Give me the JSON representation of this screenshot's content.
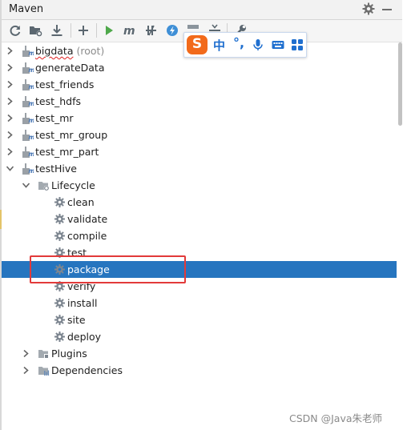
{
  "panel": {
    "title": "Maven",
    "settings_icon": "gear-icon",
    "minimize_icon": "minimize-icon"
  },
  "toolbar": {
    "buttons": [
      {
        "icon": "reload-icon",
        "name": "reload-projects-button"
      },
      {
        "icon": "generate-sources-icon",
        "name": "generate-sources-button"
      },
      {
        "icon": "download-icon",
        "name": "download-sources-button"
      },
      {
        "icon": "add-icon",
        "name": "add-project-button"
      },
      {
        "icon": "run-icon",
        "name": "run-build-button"
      },
      {
        "icon": "maven-goal-icon",
        "name": "execute-goal-button"
      },
      {
        "icon": "toggle-offline-icon",
        "name": "toggle-offline-button"
      },
      {
        "icon": "skip-tests-icon",
        "name": "skip-tests-button"
      },
      {
        "icon": "show-dependencies-icon",
        "name": "show-dependencies-button"
      },
      {
        "icon": "collapse-all-icon",
        "name": "collapse-all-button"
      },
      {
        "icon": "wrench-icon",
        "name": "maven-settings-button"
      }
    ]
  },
  "ime_toolbar": {
    "logo_letter": "S",
    "mode": "中",
    "punctuation": "°,",
    "icons": [
      "microphone-icon",
      "keyboard-icon",
      "grid-icon"
    ],
    "colors": {
      "logo": "#f26a1b",
      "accent": "#1f6fcf"
    }
  },
  "tree": {
    "projects": [
      {
        "label": "bigdata",
        "hint": "(root)",
        "expanded": false
      },
      {
        "label": "generateData",
        "expanded": false
      },
      {
        "label": "test_friends",
        "expanded": false
      },
      {
        "label": "test_hdfs",
        "expanded": false
      },
      {
        "label": "test_mr",
        "expanded": false
      },
      {
        "label": "test_mr_group",
        "expanded": false
      },
      {
        "label": "test_mr_part",
        "expanded": false
      },
      {
        "label": "testHive",
        "expanded": true
      }
    ],
    "lifecycle": {
      "label": "Lifecycle",
      "goals": [
        "clean",
        "validate",
        "compile",
        "test",
        "package",
        "verify",
        "install",
        "site",
        "deploy"
      ],
      "selected": "package"
    },
    "plugins": {
      "label": "Plugins"
    },
    "dependencies": {
      "label": "Dependencies"
    }
  },
  "colors": {
    "selection": "#2675bf",
    "highlight_box": "#e23a3a",
    "goal_icon": "#7d8690"
  },
  "watermark": "CSDN @Java朱老师"
}
